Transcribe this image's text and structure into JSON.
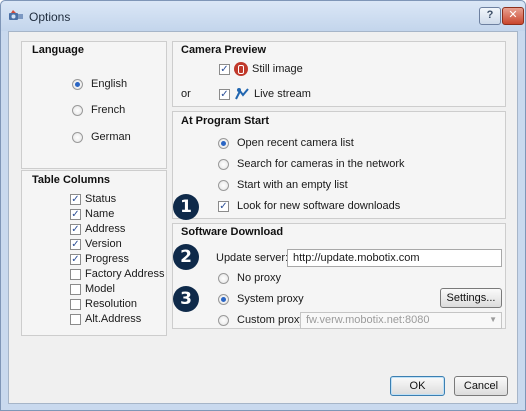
{
  "window": {
    "title": "Options",
    "help_label": "?",
    "close_label": "✕"
  },
  "language": {
    "heading": "Language",
    "options": [
      "English",
      "French",
      "German"
    ],
    "selected": "English"
  },
  "table_columns": {
    "heading": "Table Columns",
    "items": [
      {
        "label": "Status",
        "checked": true
      },
      {
        "label": "Name",
        "checked": true
      },
      {
        "label": "Address",
        "checked": true
      },
      {
        "label": "Version",
        "checked": true
      },
      {
        "label": "Progress",
        "checked": true
      },
      {
        "label": "Factory Address",
        "checked": false
      },
      {
        "label": "Model",
        "checked": false
      },
      {
        "label": "Resolution",
        "checked": false
      },
      {
        "label": "Alt.Address",
        "checked": false
      }
    ]
  },
  "camera_preview": {
    "heading": "Camera Preview",
    "or_label": "or",
    "still_image": {
      "label": "Still image",
      "checked": true,
      "icon": "still-image-icon"
    },
    "live_stream": {
      "label": "Live stream",
      "checked": true,
      "icon": "live-stream-icon"
    }
  },
  "at_program_start": {
    "heading": "At Program Start",
    "options": [
      "Open recent camera list",
      "Search for cameras in the network",
      "Start with an empty list"
    ],
    "selected": "Open recent camera list",
    "look_for_downloads": {
      "label": "Look for new software downloads",
      "checked": true
    }
  },
  "software_download": {
    "heading": "Software Download",
    "update_server_label": "Update server:",
    "update_server_value": "http://update.mobotix.com",
    "proxy_options": [
      "No proxy",
      "System proxy",
      "Custom proxy"
    ],
    "selected_proxy": "System proxy",
    "settings_label": "Settings...",
    "custom_proxy_value": "fw.verw.mobotix.net:8080"
  },
  "callouts": [
    "1",
    "2",
    "3"
  ],
  "footer": {
    "ok_label": "OK",
    "cancel_label": "Cancel"
  },
  "colors": {
    "callout_bg": "#0f2a4a",
    "radio_dot": "#2a65c4",
    "titlebar": "#c9d9ee"
  }
}
